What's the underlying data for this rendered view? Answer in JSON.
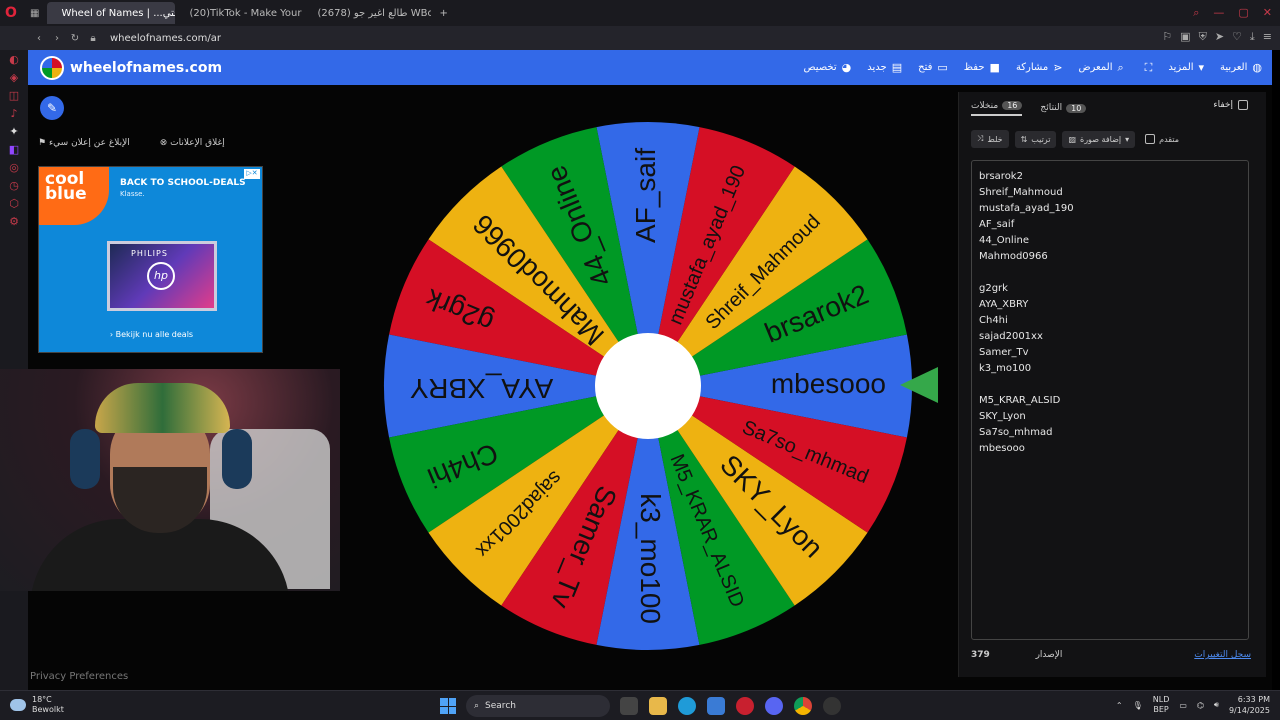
{
  "browser": {
    "tabs": [
      {
        "label": "Wheel of Names | ...اجتي",
        "active": true,
        "fav_color": "#e0243b"
      },
      {
        "label": "(20)TikTok - Make Your D...",
        "active": false,
        "fav_color": "#ffffff"
      },
      {
        "label": "طالع اغير جو (2678) WBoY",
        "active": false,
        "fav_color": "#e0243b"
      }
    ],
    "new_tab": "+",
    "url": "wheelofnames.com/ar"
  },
  "site": {
    "title": "wheelofnames.com",
    "menu": [
      {
        "label": "تخصيص",
        "icon": "palette-icon",
        "glyph": "◕"
      },
      {
        "label": "جديد",
        "icon": "file-icon",
        "glyph": "▤"
      },
      {
        "label": "فتح",
        "icon": "folder-icon",
        "glyph": "▭"
      },
      {
        "label": "حفظ",
        "icon": "save-icon",
        "glyph": "■"
      },
      {
        "label": "مشاركة",
        "icon": "share-icon",
        "glyph": "⋖"
      },
      {
        "label": "المعرض",
        "icon": "search-icon",
        "glyph": "⌕"
      },
      {
        "label": "",
        "icon": "fullscreen-icon",
        "glyph": "⛶"
      },
      {
        "label": "المزيد",
        "icon": "chevron-down-icon",
        "glyph": "▾"
      },
      {
        "label": "العربية",
        "icon": "globe-icon",
        "glyph": "◍"
      }
    ]
  },
  "ad": {
    "report_label": "الإبلاغ عن إعلان سيء",
    "close_label": "إغلاق الإعلانات",
    "brand": "cool blue",
    "headline": "BACK TO SCHOOL-DEALS",
    "sub": "Klasse.",
    "product_brand": "PHILIPS",
    "hp": "hp",
    "cta": "› Bekijk nu alle deals"
  },
  "privacy": "Privacy Preferences",
  "wheel": {
    "colors": [
      "#3369e8",
      "#009925",
      "#eeb211",
      "#d50f25"
    ],
    "segments": [
      "mbesooo",
      "brsarok2",
      "Shreif_Mahmoud",
      "mustafa_ayad_190",
      "AF_saif",
      "44_Online",
      "Mahmod0966",
      "g2grk",
      "AYA_XBRY",
      "Ch4hi",
      "sajad2001xx",
      "Samer_Tv",
      "k3_mo100",
      "M5_KRAR_ALSID",
      "SKY_Lyon",
      "Sa7so_mhmad"
    ]
  },
  "panel": {
    "tabs": [
      {
        "label": "منخلات",
        "count": "16",
        "active": true
      },
      {
        "label": "النتائج",
        "count": "10",
        "active": false
      }
    ],
    "hide_label": "إخفاء",
    "toolbar": {
      "shuffle": "خلط",
      "sort": "ترتيب",
      "add_image": "إضافة صورة",
      "advanced": "متقدم"
    },
    "entries": [
      "brsarok2",
      "Shreif_Mahmoud",
      "mustafa_ayad_190",
      "AF_saif",
      "44_Online",
      "Mahmod0966",
      "",
      "g2grk",
      "AYA_XBRY",
      "Ch4hi",
      "sajad2001xx",
      "Samer_Tv",
      "k3_mo100",
      "",
      "M5_KRAR_ALSID",
      "SKY_Lyon",
      "Sa7so_mhmad",
      "mbesooo"
    ],
    "version_label": "الإصدار",
    "version": "379",
    "changelog": "سجل التغييرات"
  },
  "taskbar": {
    "temp": "18°C",
    "weather": "Bewolkt",
    "search": "Search",
    "lang": "NLD",
    "region": "BEP",
    "time": "6:33 PM",
    "date": "9/14/2025"
  }
}
